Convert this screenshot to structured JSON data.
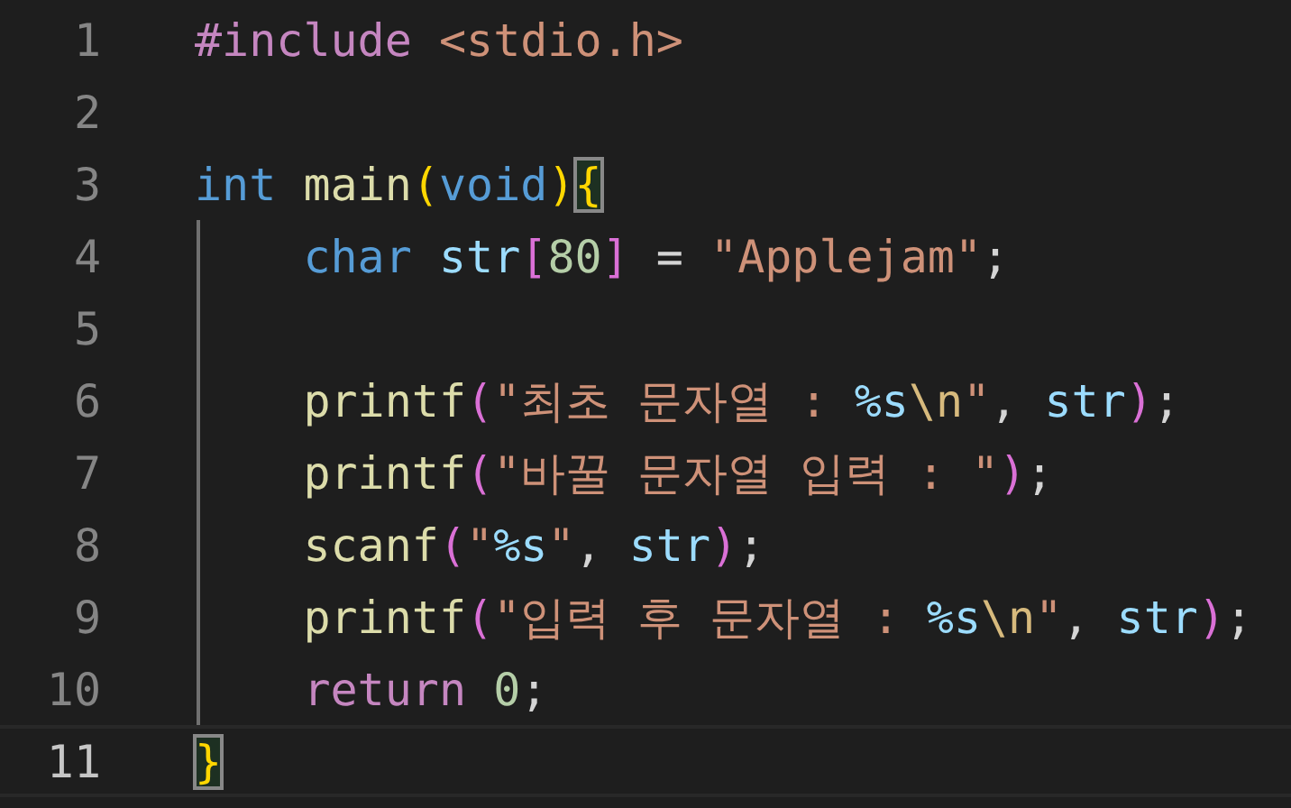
{
  "editor": {
    "lines": [
      {
        "number": "1",
        "current": false,
        "guide": false,
        "tokens": [
          {
            "text": "#include ",
            "kind": "directive"
          },
          {
            "text": "<stdio.h>",
            "kind": "string"
          }
        ]
      },
      {
        "number": "2",
        "current": false,
        "guide": false
      },
      {
        "number": "3",
        "current": false,
        "guide": false,
        "tokens": [
          {
            "text": "int ",
            "kind": "keyword"
          },
          {
            "text": "main",
            "kind": "function"
          },
          {
            "text": "(",
            "kind": "paren1"
          },
          {
            "text": "void",
            "kind": "keyword"
          },
          {
            "text": ")",
            "kind": "paren1"
          },
          {
            "text": "{",
            "kind": "paren1",
            "matched": true
          }
        ]
      },
      {
        "number": "4",
        "current": false,
        "guide": true,
        "tokens": [
          {
            "text": "    char ",
            "kind": "keyword"
          },
          {
            "text": "str",
            "kind": "variable"
          },
          {
            "text": "[",
            "kind": "paren2"
          },
          {
            "text": "80",
            "kind": "number"
          },
          {
            "text": "]",
            "kind": "paren2"
          },
          {
            "text": " = ",
            "kind": "plain"
          },
          {
            "text": "\"Applejam\"",
            "kind": "string"
          },
          {
            "text": ";",
            "kind": "plain"
          }
        ]
      },
      {
        "number": "5",
        "current": false,
        "guide": true
      },
      {
        "number": "6",
        "current": false,
        "guide": true,
        "tokens": [
          {
            "text": "    printf",
            "kind": "function"
          },
          {
            "text": "(",
            "kind": "paren2"
          },
          {
            "text": "\"최초 문자열 : ",
            "kind": "string"
          },
          {
            "text": "%s",
            "kind": "format"
          },
          {
            "text": "\\n",
            "kind": "escape"
          },
          {
            "text": "\"",
            "kind": "string"
          },
          {
            "text": ", ",
            "kind": "plain"
          },
          {
            "text": "str",
            "kind": "variable"
          },
          {
            "text": ")",
            "kind": "paren2"
          },
          {
            "text": ";",
            "kind": "plain"
          }
        ]
      },
      {
        "number": "7",
        "current": false,
        "guide": true,
        "tokens": [
          {
            "text": "    printf",
            "kind": "function"
          },
          {
            "text": "(",
            "kind": "paren2"
          },
          {
            "text": "\"바꿀 문자열 입력 : \"",
            "kind": "string"
          },
          {
            "text": ")",
            "kind": "paren2"
          },
          {
            "text": ";",
            "kind": "plain"
          }
        ]
      },
      {
        "number": "8",
        "current": false,
        "guide": true,
        "tokens": [
          {
            "text": "    scanf",
            "kind": "function"
          },
          {
            "text": "(",
            "kind": "paren2"
          },
          {
            "text": "\"",
            "kind": "string"
          },
          {
            "text": "%s",
            "kind": "format"
          },
          {
            "text": "\"",
            "kind": "string"
          },
          {
            "text": ", ",
            "kind": "plain"
          },
          {
            "text": "str",
            "kind": "variable"
          },
          {
            "text": ")",
            "kind": "paren2"
          },
          {
            "text": ";",
            "kind": "plain"
          }
        ]
      },
      {
        "number": "9",
        "current": false,
        "guide": true,
        "tokens": [
          {
            "text": "    printf",
            "kind": "function"
          },
          {
            "text": "(",
            "kind": "paren2"
          },
          {
            "text": "\"입력 후 문자열 : ",
            "kind": "string"
          },
          {
            "text": "%s",
            "kind": "format"
          },
          {
            "text": "\\n",
            "kind": "escape"
          },
          {
            "text": "\"",
            "kind": "string"
          },
          {
            "text": ", ",
            "kind": "plain"
          },
          {
            "text": "str",
            "kind": "variable"
          },
          {
            "text": ")",
            "kind": "paren2"
          },
          {
            "text": ";",
            "kind": "plain"
          }
        ]
      },
      {
        "number": "10",
        "current": false,
        "guide": true,
        "tokens": [
          {
            "text": "    return ",
            "kind": "control"
          },
          {
            "text": "0",
            "kind": "number"
          },
          {
            "text": ";",
            "kind": "plain"
          }
        ]
      },
      {
        "number": "11",
        "current": true,
        "guide": false,
        "tokens": [
          {
            "text": "}",
            "kind": "paren1",
            "matched": true
          }
        ]
      }
    ]
  }
}
